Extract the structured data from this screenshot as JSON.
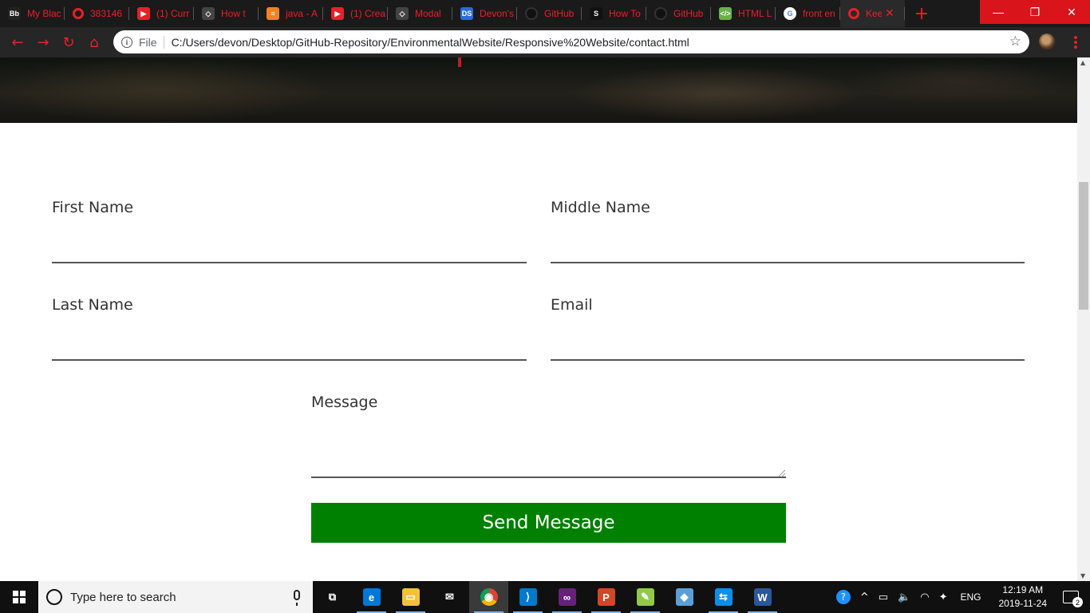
{
  "browser": {
    "tabs": [
      {
        "title": "My Blac",
        "icon": "blackboard-icon",
        "fav_text": "Bb",
        "color": "#222222"
      },
      {
        "title": "383146",
        "icon": "opera-o-icon",
        "fav_text": "",
        "color": "#e8202a"
      },
      {
        "title": "(1) Curr",
        "icon": "youtube-icon",
        "fav_text": "▶",
        "color": "#e8202a"
      },
      {
        "title": "How t",
        "icon": "codepen-icon",
        "fav_text": "◇",
        "color": "#444444"
      },
      {
        "title": "java - A",
        "icon": "stackoverflow-icon",
        "fav_text": "≡",
        "color": "#f48024"
      },
      {
        "title": "(1) Crea",
        "icon": "youtube-icon",
        "fav_text": "▶",
        "color": "#e8202a"
      },
      {
        "title": "Modal",
        "icon": "codepen-icon",
        "fav_text": "◇",
        "color": "#444444"
      },
      {
        "title": "Devon's",
        "icon": "ds-icon",
        "fav_text": "DS",
        "color": "#2d6cdf"
      },
      {
        "title": "GitHub",
        "icon": "github-icon",
        "fav_text": "",
        "color": "#111111"
      },
      {
        "title": "How To",
        "icon": "s-logo-icon",
        "fav_text": "S",
        "color": "#111111"
      },
      {
        "title": "GitHub",
        "icon": "github-icon",
        "fav_text": "",
        "color": "#111111"
      },
      {
        "title": "HTML L",
        "icon": "html-icon",
        "fav_text": "</>",
        "color": "#6ab04c"
      },
      {
        "title": "front en",
        "icon": "google-icon",
        "fav_text": "G",
        "color": "#ffffff"
      },
      {
        "title": "Kee",
        "icon": "opera-o-icon",
        "fav_text": "",
        "color": "#e8202a"
      }
    ],
    "new_tab": "+",
    "window_controls": {
      "minimize": "—",
      "restore": "❐",
      "close": "✕"
    },
    "nav": {
      "back": "←",
      "forward": "→",
      "reload": "↻",
      "home": "⌂"
    },
    "address": {
      "scheme": "File",
      "url": "C:/Users/devon/Desktop/GitHub-Repository/EnvironmentalWebsite/Responsive%20Website/contact.html",
      "info_glyph": "i",
      "star": "☆"
    },
    "accent": "#e8202a"
  },
  "form": {
    "first_name_label": "First Name",
    "middle_name_label": "Middle Name",
    "last_name_label": "Last Name",
    "email_label": "Email",
    "message_label": "Message",
    "first_name_value": "",
    "middle_name_value": "",
    "last_name_value": "",
    "email_value": "",
    "message_value": "",
    "submit_label": "Send Message",
    "submit_color": "#008000"
  },
  "scrollbar": {
    "up": "▲",
    "down": "▼"
  },
  "taskbar": {
    "search_placeholder": "Type here to search",
    "apps": [
      {
        "name": "task-view",
        "glyph": "⧉",
        "color": "#101010"
      },
      {
        "name": "edge",
        "glyph": "e",
        "color": "#0078d7"
      },
      {
        "name": "file-explorer",
        "glyph": "▭",
        "color": "#f3c13a"
      },
      {
        "name": "mail",
        "glyph": "✉",
        "color": "#101010"
      },
      {
        "name": "chrome",
        "glyph": "◉",
        "color": "#db4437"
      },
      {
        "name": "vscode",
        "glyph": "⟩",
        "color": "#007acc"
      },
      {
        "name": "visual-studio",
        "glyph": "∞",
        "color": "#68217a"
      },
      {
        "name": "powerpoint",
        "glyph": "P",
        "color": "#d24726"
      },
      {
        "name": "notepad-plus",
        "glyph": "✎",
        "color": "#90c94b"
      },
      {
        "name": "snipping",
        "glyph": "◆",
        "color": "#5aa0d8"
      },
      {
        "name": "teamviewer",
        "glyph": "⇆",
        "color": "#0e8ee9"
      },
      {
        "name": "word",
        "glyph": "W",
        "color": "#2b579a"
      }
    ],
    "tray": {
      "help": "?",
      "chevron": "^",
      "battery": "▭",
      "volume": "🔈",
      "wifi": "◠",
      "dropbox": "✦",
      "language": "ENG",
      "time": "12:19 AM",
      "date": "2019-11-24",
      "notifications": "2"
    }
  }
}
